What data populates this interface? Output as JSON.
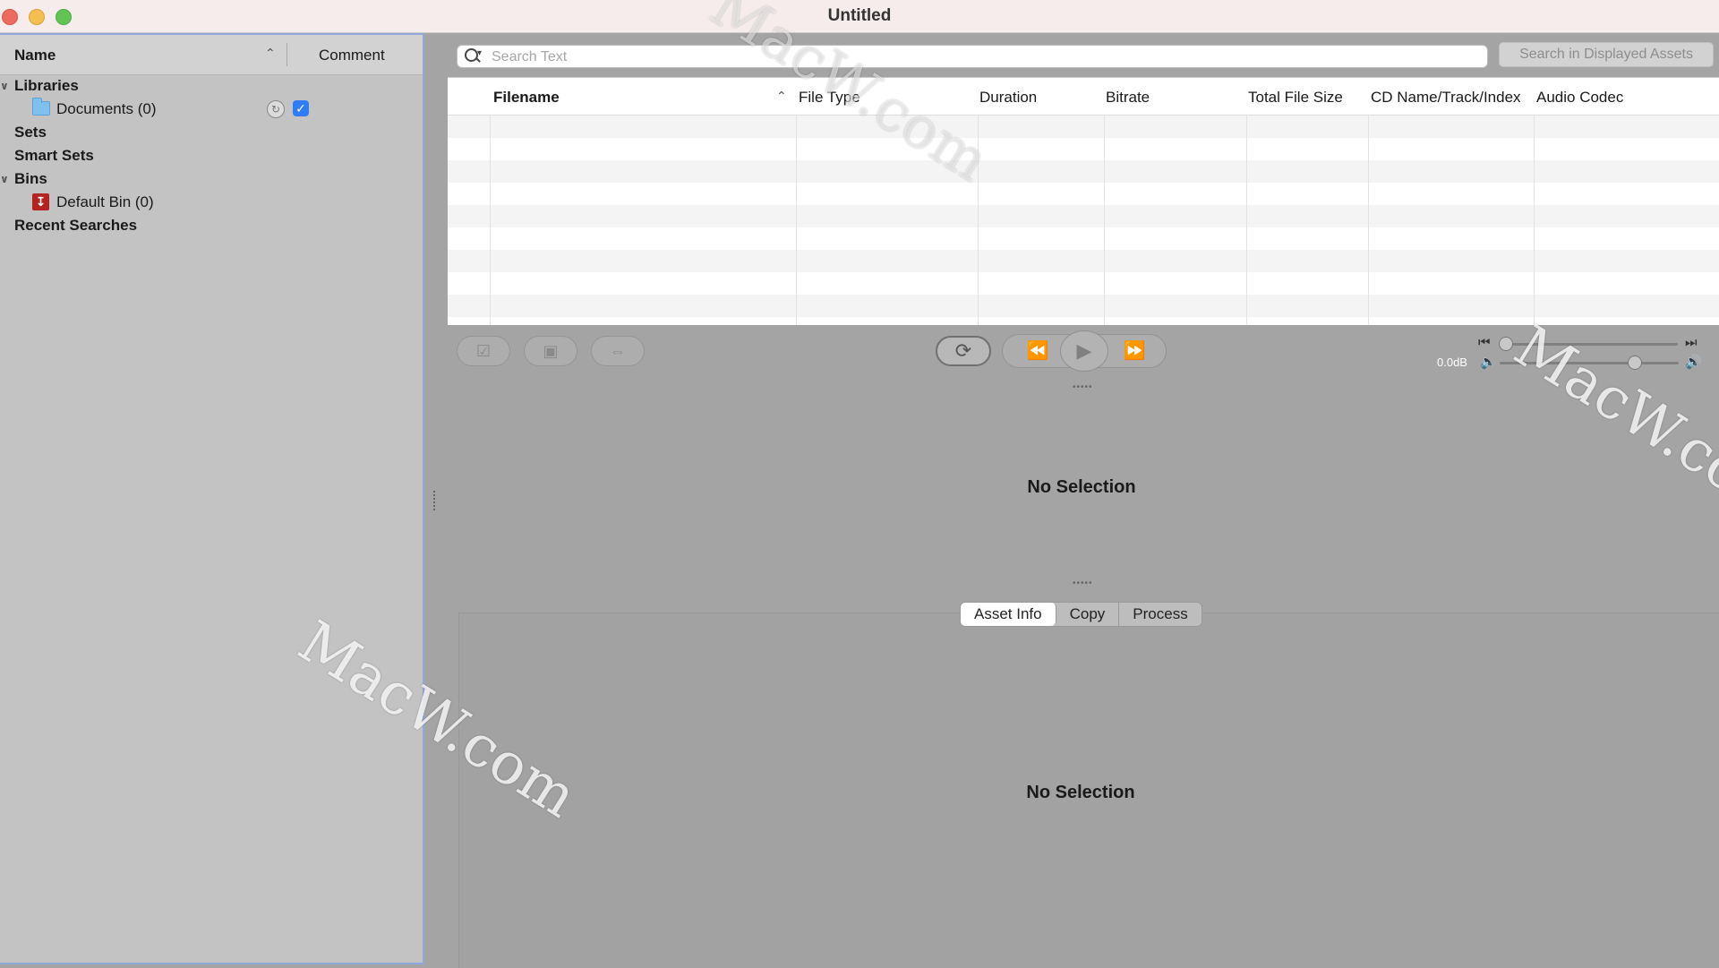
{
  "window": {
    "title": "Untitled"
  },
  "sidebar": {
    "columns": {
      "name": "Name",
      "comment": "Comment"
    },
    "items": [
      {
        "label": "Libraries"
      },
      {
        "label": "Documents (0)"
      },
      {
        "label": "Sets"
      },
      {
        "label": "Smart Sets"
      },
      {
        "label": "Bins"
      },
      {
        "label": "Default Bin (0)"
      },
      {
        "label": "Recent Searches"
      }
    ]
  },
  "search": {
    "placeholder": "Search Text",
    "button_label": "Search in Displayed Assets"
  },
  "table": {
    "columns": [
      "Filename",
      "File Type",
      "Duration",
      "Bitrate",
      "Total File Size",
      "CD Name/Track/Index",
      "Audio Codec"
    ],
    "sorted_column": "Filename",
    "rows": []
  },
  "transport": {
    "gain_label": "0.0dB"
  },
  "preview": {
    "empty_text": "No Selection"
  },
  "tabs": [
    {
      "label": "Asset Info",
      "active": true
    },
    {
      "label": "Copy",
      "active": false
    },
    {
      "label": "Process",
      "active": false
    }
  ],
  "inspector": {
    "empty_text": "No Selection"
  },
  "watermark": {
    "text": "MacW.com"
  },
  "colors": {
    "accent": "#2e7cf6",
    "sidebar_border": "#8fa8d8",
    "close": "#ed6a5e",
    "minimize": "#f5bf4f",
    "maximize": "#61c554",
    "bin_icon": "#b52222",
    "folder_icon": "#7fc0ee"
  }
}
